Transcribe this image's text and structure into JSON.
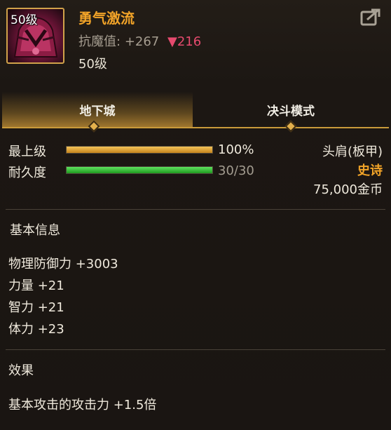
{
  "item": {
    "level_badge": "50级",
    "name": "勇气激流",
    "magic_resist_label": "抗魔值:",
    "magic_resist_value": "+267",
    "magic_resist_diff": "▼216",
    "required_level": "50级",
    "icon": "epic-shoulder-armor-icon"
  },
  "share_icon": "share-export-icon",
  "tabs": [
    {
      "label": "地下城",
      "active": true
    },
    {
      "label": "决斗模式",
      "active": false
    }
  ],
  "stats": {
    "grade_label": "最上级",
    "grade_value": "100%",
    "grade_fraction": 1.0,
    "durability_label": "耐久度",
    "durability_value": "30/30",
    "durability_fraction": 1.0
  },
  "item_info": {
    "slot": "头肩(板甲)",
    "rarity": "史诗",
    "price": "75,000金币"
  },
  "basic_info": {
    "title": "基本信息",
    "attributes": [
      "物理防御力 +3003",
      "力量 +21",
      "智力 +21",
      "体力 +23"
    ]
  },
  "effects": {
    "title": "效果",
    "lines": [
      "基本攻击的攻击力 +1.5倍"
    ]
  },
  "colors": {
    "name": "#f1a328",
    "rarity_epic": "#f1a328",
    "resist_down": "#e64a6e",
    "tab_accent": "#d69e34"
  }
}
